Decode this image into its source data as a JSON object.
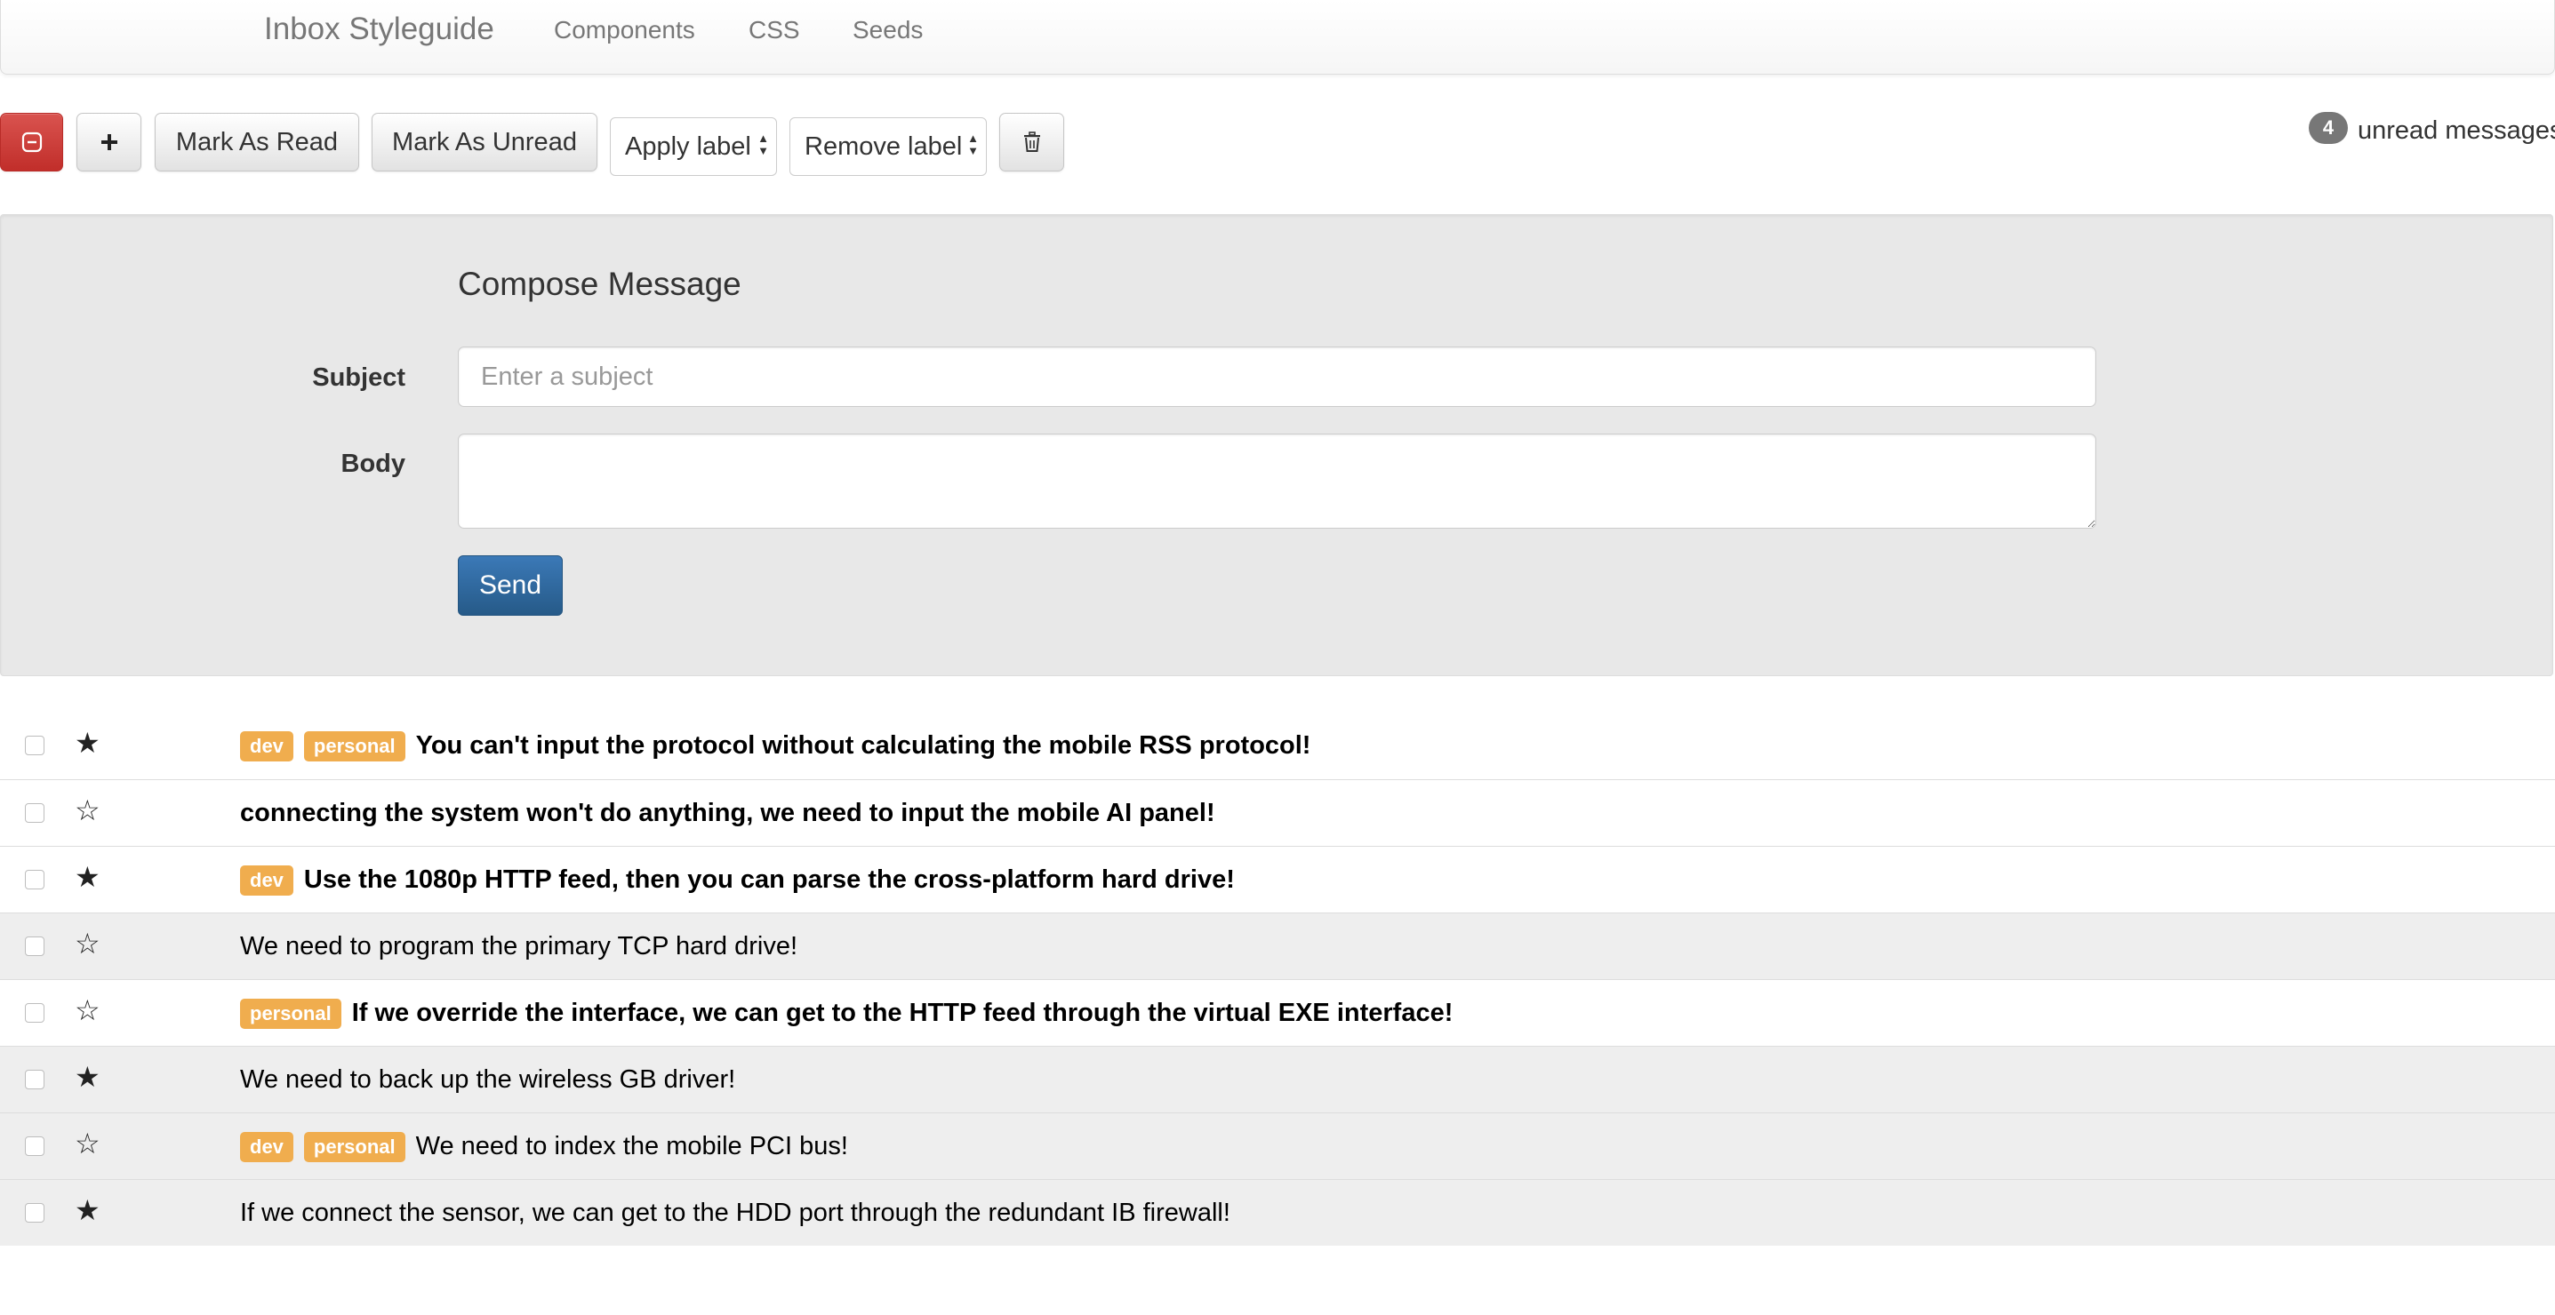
{
  "navbar": {
    "brand": "Inbox Styleguide",
    "links": [
      "Components",
      "CSS",
      "Seeds"
    ]
  },
  "toolbar": {
    "select_all_icon": "minus-square-icon",
    "compose_icon": "plus-icon",
    "mark_read": "Mark As Read",
    "mark_unread": "Mark As Unread",
    "apply_label": "Apply label",
    "remove_label": "Remove label",
    "delete_icon": "trash-icon",
    "unread_count": "4",
    "unread_text": "unread messages"
  },
  "compose": {
    "title": "Compose Message",
    "subject_label": "Subject",
    "subject_placeholder": "Enter a subject",
    "body_label": "Body",
    "send": "Send"
  },
  "messages": [
    {
      "read": false,
      "starred": true,
      "labels": [
        "dev",
        "personal"
      ],
      "subject": "You can't input the protocol without calculating the mobile RSS protocol!"
    },
    {
      "read": false,
      "starred": false,
      "labels": [],
      "subject": "connecting the system won't do anything, we need to input the mobile AI panel!"
    },
    {
      "read": false,
      "starred": true,
      "labels": [
        "dev"
      ],
      "subject": "Use the 1080p HTTP feed, then you can parse the cross-platform hard drive!"
    },
    {
      "read": true,
      "starred": false,
      "labels": [],
      "subject": "We need to program the primary TCP hard drive!"
    },
    {
      "read": false,
      "starred": false,
      "labels": [
        "personal"
      ],
      "subject": "If we override the interface, we can get to the HTTP feed through the virtual EXE interface!"
    },
    {
      "read": true,
      "starred": true,
      "labels": [],
      "subject": "We need to back up the wireless GB driver!"
    },
    {
      "read": true,
      "starred": false,
      "labels": [
        "dev",
        "personal"
      ],
      "subject": "We need to index the mobile PCI bus!"
    },
    {
      "read": true,
      "starred": true,
      "labels": [],
      "subject": "If we connect the sensor, we can get to the HDD port through the redundant IB firewall!"
    }
  ],
  "colors": {
    "danger": "#d9534f",
    "primary": "#337ab7",
    "label": "#f0ad4e",
    "badge": "#777777",
    "read_row": "#eeeeee"
  }
}
